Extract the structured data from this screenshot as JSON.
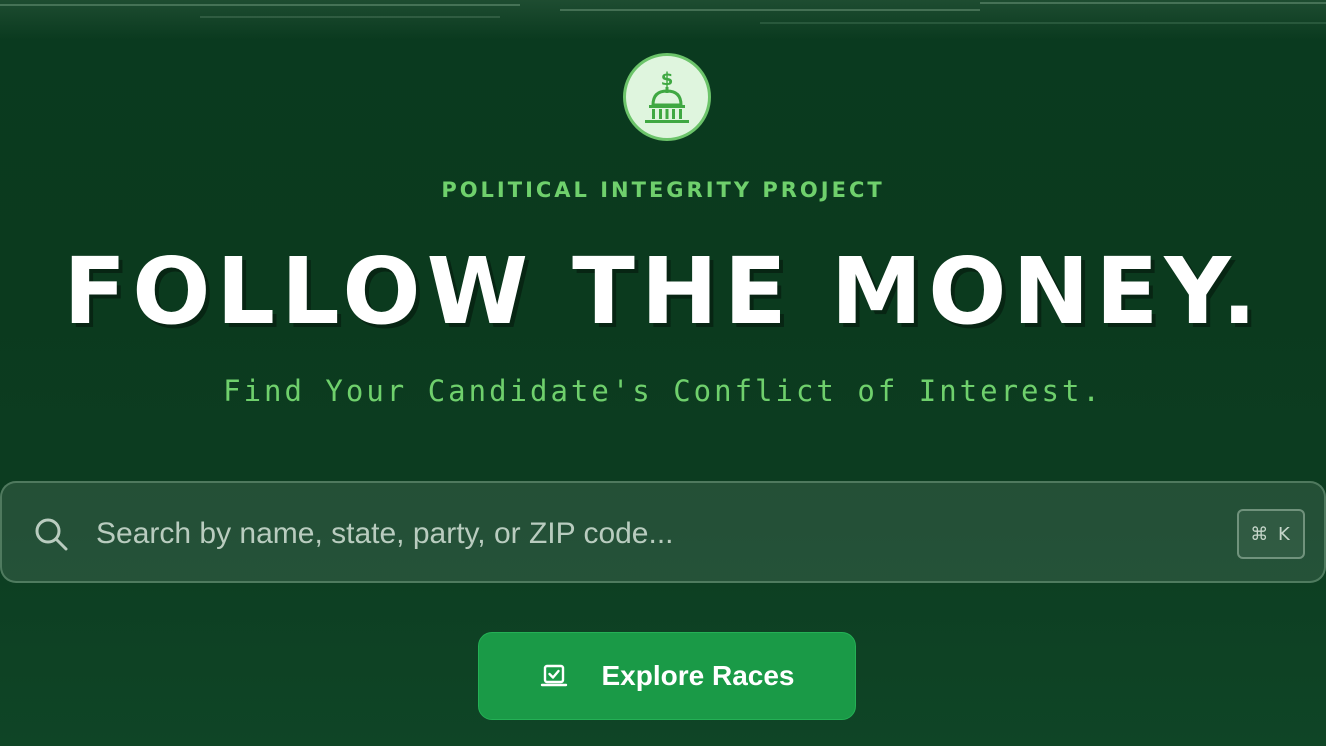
{
  "logo": {
    "icon": "capitol-dollar-icon"
  },
  "brand": {
    "org_name": "POLITICAL INTEGRITY PROJECT"
  },
  "hero": {
    "headline": "FOLLOW THE MONEY.",
    "tagline": "Find Your Candidate's Conflict of Interest."
  },
  "search": {
    "placeholder": "Search by name, state, party, or ZIP code...",
    "value": "",
    "shortcut": "⌘ K",
    "icon": "search-icon"
  },
  "cta": {
    "label": "Explore Races",
    "icon": "ballot-box-icon"
  },
  "colors": {
    "background": "#0b3a1e",
    "accent_text": "#6fd06c",
    "button": "#1a9a47"
  }
}
